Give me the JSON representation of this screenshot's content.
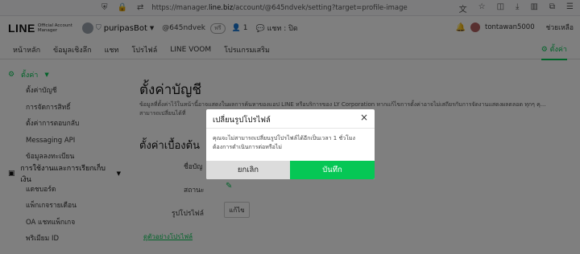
{
  "browser": {
    "url_prefix": "https://manager.",
    "url_domain": "line.biz",
    "url_path": "/account/@645ndvek/setting?target=profile-image"
  },
  "header": {
    "logo_main": "LINE",
    "logo_sub_1": "Official Account",
    "logo_sub_2": "Manager",
    "bot_name": "puripasBot",
    "bot_id": "@645ndvek",
    "badge": "ฟรี",
    "friend_count": "1",
    "chat_status": "แชท : ปิด",
    "user_name": "tontawan5000",
    "help": "ช่วยเหลือ"
  },
  "tabs": [
    "หน้าหลัก",
    "ข้อมูลเชิงลึก",
    "แชท",
    "โปรไฟล์",
    "LINE VOOM",
    "โปรแกรมเสริม"
  ],
  "tab_settings": "ตั้งค่า",
  "sidebar": {
    "section1": "ตั้งค่า",
    "section1_items": [
      "ตั้งค่าบัญชี",
      "การจัดการสิทธิ์",
      "ตั้งค่าการตอบกลับ",
      "Messaging API",
      "ข้อมูลลงทะเบียน"
    ],
    "section2": "การใช้งานและการเรียกเก็บเงิน",
    "section2_items": [
      "แดชบอร์ด",
      "แพ็กเกจรายเดือน",
      "OA แชทแพ็กเกจ",
      "พริเมียม ID"
    ]
  },
  "main": {
    "title": "ตั้งค่าบัญชี",
    "desc": "ข้อมูลที่ตั้งค่าไว้ในหน้านี้อาจแสดงในผลการค้นหาของแอป LINE หรือบริการของ LY Corporation หากแก้ไขการตั้งค่าอาจไม่เสถียรกับการจัดงานแสดงผลตลอด ทุกๆ คุ... สามารถเปลี่ยนได้ที่",
    "section_title": "ตั้งค่าเบื้องต้น",
    "label_name": "ชื่อบัญ",
    "label_status": "สถานะ",
    "label_profile": "รูปโปรไฟล์",
    "edit_button": "แก้ไข",
    "example_link": "ดูตัวอย่างโปรไฟล์"
  },
  "modal": {
    "title": "เปลี่ยนรูปโปรไฟล์",
    "close": "×",
    "body": "คุณจะไม่สามารถเปลี่ยนรูปโปรไฟล์ได้อีกเป็นเวลา 1 ชั่วโมง ต้องการดำเนินการต่อหรือไม่",
    "cancel": "ยกเลิก",
    "save": "บันทึก"
  },
  "colors": {
    "accent": "#06c755",
    "overlay": "rgba(0,0,0,0.5)"
  }
}
